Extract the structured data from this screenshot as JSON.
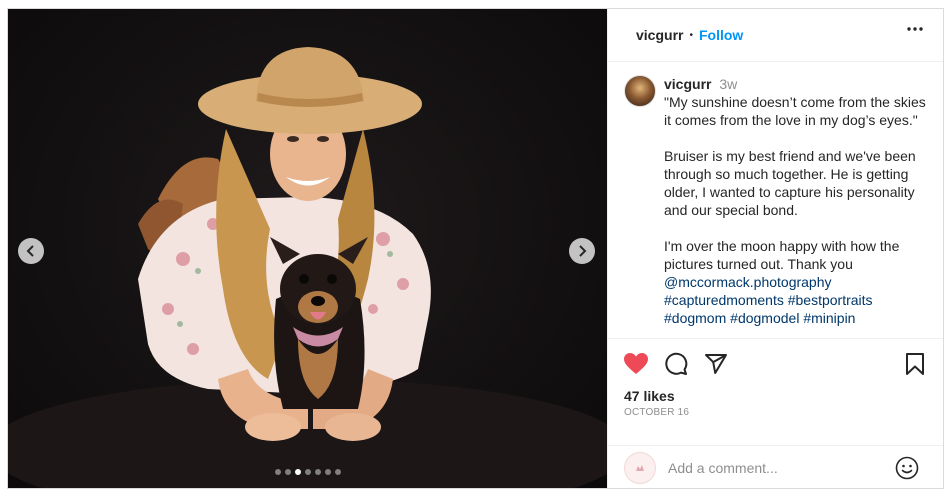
{
  "post": {
    "username": "vicgurr",
    "follow_label": "Follow",
    "separator": "•",
    "time_ago": "3w",
    "caption_lines": [
      "\"My sunshine doesn’t come from the skies it comes from the love in my dog’s eyes.\"",
      "Bruiser is my best friend and we've been through so much together. He is getting older, I wanted to capture his personality and our special bond.",
      "I'm over the moon happy with how the pictures turned out. Thank you"
    ],
    "links": [
      "@mccormack.photography",
      "#capturedmoments",
      "#bestportraits",
      "#dogmom",
      "#dogmodel",
      "#minipin"
    ],
    "likes": "47 likes",
    "date": "OCTOBER 16"
  },
  "carousel": {
    "total": 7,
    "active_index": 2
  },
  "comment_box": {
    "placeholder": "Add a comment..."
  },
  "icons": {
    "prev": "chevron-left-icon",
    "next": "chevron-right-icon",
    "more": "more-options-icon",
    "like": "heart-icon",
    "comment": "comment-icon",
    "share": "share-icon",
    "save": "bookmark-icon",
    "emoji": "emoji-icon"
  },
  "colors": {
    "accent": "#0095f6",
    "link": "#00376b",
    "like": "#ed4956",
    "muted": "#8e8e8e",
    "text": "#262626"
  }
}
